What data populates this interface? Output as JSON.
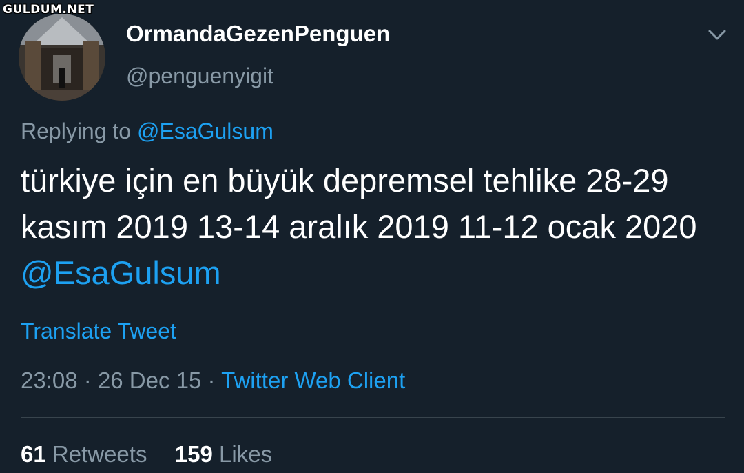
{
  "watermark": "GULDUM.NET",
  "user": {
    "display_name": "OrmandaGezenPenguen",
    "handle": "@penguenyigit",
    "avatar_icon": "avatar-photo-arcade-hall"
  },
  "reply": {
    "prefix": "Replying to",
    "target": "@EsaGulsum"
  },
  "tweet": {
    "text": "türkiye için en büyük depremsel tehlike 28-29 kasım 2019 13-14 aralık 2019 11-12 ocak 2020",
    "mention": "@EsaGulsum"
  },
  "translate_label": "Translate Tweet",
  "meta": {
    "time": "23:08",
    "separator": "·",
    "date": "26 Dec 15",
    "client": "Twitter Web Client"
  },
  "stats": {
    "retweets_count": "61",
    "retweets_label": "Retweets",
    "likes_count": "159",
    "likes_label": "Likes"
  },
  "colors": {
    "background": "#15202b",
    "link": "#1da1f2",
    "secondary_text": "#8899a6",
    "divider": "#38444d"
  },
  "icons": {
    "more": "chevron-down-icon"
  }
}
